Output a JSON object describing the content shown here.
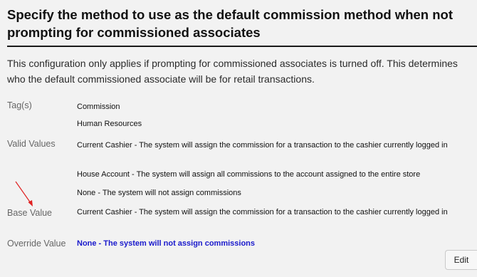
{
  "page": {
    "title": "Specify the method to use as the default commission method when not prompting for commissioned associates",
    "description": "This configuration only applies if prompting for commissioned associates is turned off. This determines who the default commissioned associate will be for retail transactions."
  },
  "fields": {
    "tags_label": "Tag(s)",
    "tags": [
      "Commission",
      "Human Resources"
    ],
    "valid_values_label": "Valid Values",
    "valid_values": [
      "Current Cashier - The system will assign the commission for a transaction to the cashier currently logged in",
      "House Account - The system will assign all commissions to the account assigned to the entire store",
      "None - The system will not assign commissions"
    ],
    "base_value_label": "Base Value",
    "base_value": "Current Cashier - The system will assign the commission for a transaction to the cashier currently logged in",
    "override_value_label": "Override Value",
    "override_value": "None - The system will not assign commissions"
  },
  "actions": {
    "edit_label": "Edit"
  },
  "colors": {
    "override_value": "#1a1acc",
    "annotation_arrow": "#e02020"
  }
}
